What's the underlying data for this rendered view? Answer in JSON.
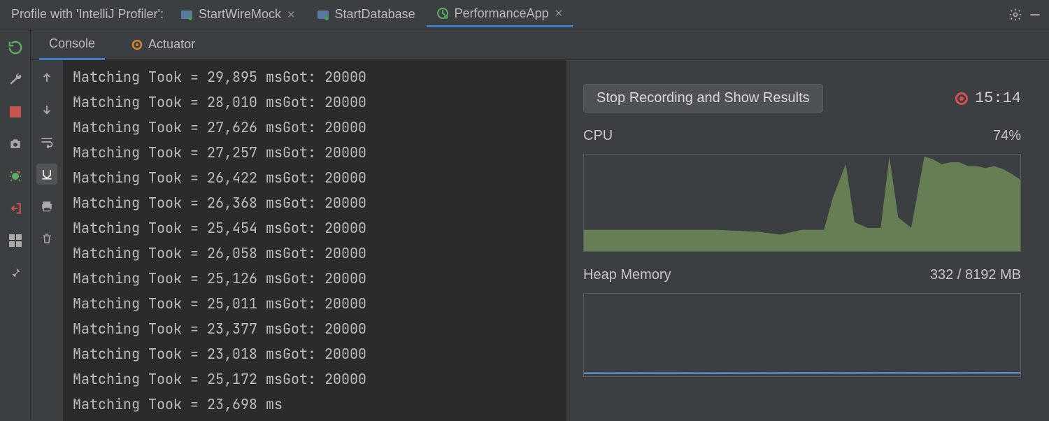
{
  "header": {
    "prefix": "Profile with 'IntelliJ Profiler':",
    "tabs": [
      {
        "label": "StartWireMock",
        "active": false,
        "closeable": true,
        "kind": "main"
      },
      {
        "label": "StartDatabase",
        "active": false,
        "closeable": false,
        "kind": "main"
      },
      {
        "label": "PerformanceApp",
        "active": true,
        "closeable": true,
        "kind": "profiler"
      }
    ]
  },
  "sub_tabs": {
    "console": "Console",
    "actuator": "Actuator"
  },
  "console_lines": [
    "Matching Took = 29,895 msGot: 20000",
    "Matching Took = 28,010 msGot: 20000",
    "Matching Took = 27,626 msGot: 20000",
    "Matching Took = 27,257 msGot: 20000",
    "Matching Took = 26,422 msGot: 20000",
    "Matching Took = 26,368 msGot: 20000",
    "Matching Took = 25,454 msGot: 20000",
    "Matching Took = 26,058 msGot: 20000",
    "Matching Took = 25,126 msGot: 20000",
    "Matching Took = 25,011 msGot: 20000",
    "Matching Took = 23,377 msGot: 20000",
    "Matching Took = 23,018 msGot: 20000",
    "Matching Took = 25,172 msGot: 20000",
    "Matching Took = 23,698 ms"
  ],
  "profiler": {
    "stop_label": "Stop Recording and Show Results",
    "elapsed": "15:14",
    "cpu_label": "CPU",
    "cpu_value": "74%",
    "heap_label": "Heap Memory",
    "heap_value": "332 / 8192 MB"
  },
  "chart_data": [
    {
      "type": "area",
      "title": "CPU",
      "ylabel": "%",
      "ylim": [
        0,
        100
      ],
      "x": [
        0,
        5,
        10,
        15,
        20,
        25,
        30,
        35,
        40,
        45,
        50,
        52,
        55,
        57,
        60,
        62,
        65,
        68,
        70,
        72,
        75,
        78,
        80,
        82,
        84,
        86,
        88,
        90,
        92,
        94,
        96,
        98,
        100
      ],
      "values": [
        22,
        22,
        22,
        22,
        22,
        22,
        22,
        21,
        20,
        17,
        22,
        22,
        22,
        55,
        90,
        30,
        24,
        24,
        98,
        35,
        24,
        98,
        95,
        90,
        92,
        92,
        88,
        88,
        86,
        88,
        85,
        80,
        74
      ],
      "color": "#6d8a57"
    },
    {
      "type": "line",
      "title": "Heap Memory",
      "ylabel": "MB",
      "ylim": [
        0,
        8192
      ],
      "x": [
        0,
        10,
        20,
        30,
        40,
        50,
        60,
        70,
        80,
        90,
        100
      ],
      "values": [
        300,
        310,
        320,
        300,
        310,
        330,
        320,
        330,
        320,
        330,
        332
      ],
      "color": "#5e8fd6"
    }
  ],
  "colors": {
    "accent": "#3c7dc6",
    "green": "#6d8a57",
    "red": "#d94e4e"
  }
}
